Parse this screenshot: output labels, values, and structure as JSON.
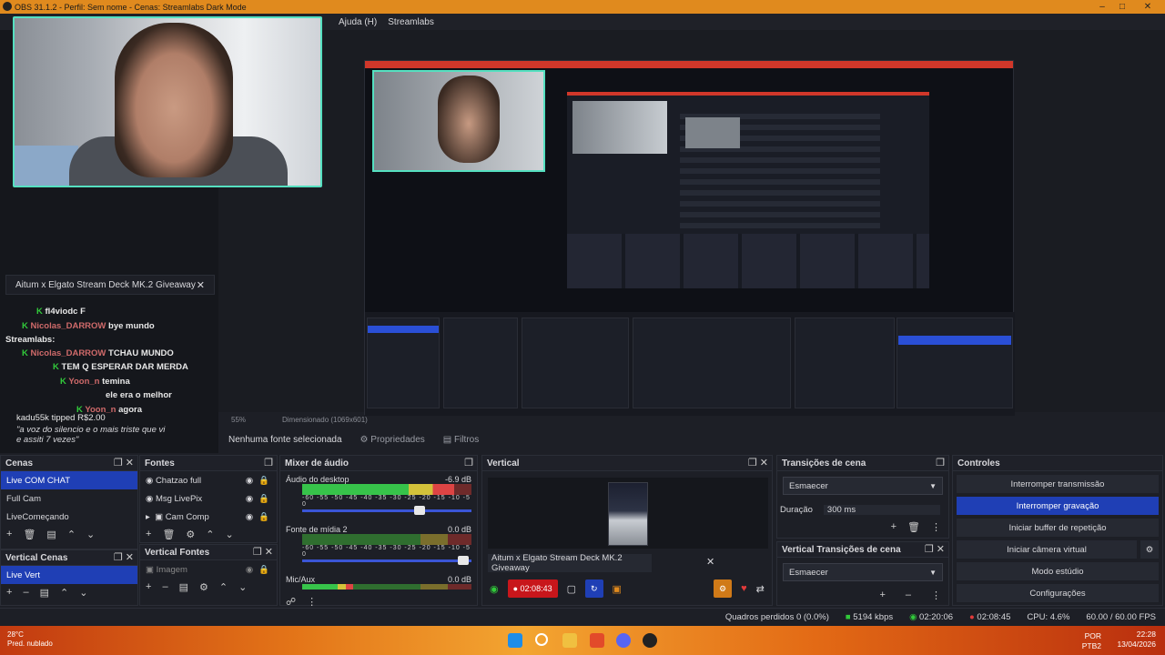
{
  "window": {
    "title": "OBS 31.1.2 - Perfil: Sem nome - Cenas: Streamlabs Dark Mode"
  },
  "menu": {
    "items": [
      "Ajuda (H)",
      "Streamlabs"
    ]
  },
  "chat_panel": {
    "giveaway": "Aitum x Elgato Stream Deck MK.2 Giveaway",
    "header": "Streamlabs:",
    "messages": [
      {
        "user": "fl4viodc",
        "text": "F"
      },
      {
        "user": "Nicolas_DARROW",
        "text": "bye mundo"
      },
      {
        "user": "Nicolas_DARROW",
        "text": "TCHAU MUNDO"
      },
      {
        "user": "",
        "text": "TEM Q ESPERAR DAR MERDA"
      },
      {
        "user": "Yoon_n",
        "text": "temina"
      },
      {
        "user": "",
        "text": "ele era o melhor"
      },
      {
        "user": "Yoon_n",
        "text": "agora"
      },
      {
        "user": "kadu55k",
        "text": "tipped R$2.00"
      },
      {
        "user": "",
        "text": "\"a voz do silencio e o mais triste que vi e assiti 7 vezes\""
      }
    ]
  },
  "preview": {
    "zoom": "55%",
    "dims": "Dimensionado (1069x601)"
  },
  "source_bar": {
    "status": "Nenhuma fonte selecionada",
    "props": "Propriedades",
    "filters": "Filtros"
  },
  "scenes": {
    "title": "Cenas",
    "items": [
      "Live COM CHAT",
      "Full Cam",
      "LiveComeçando"
    ]
  },
  "vertical_scenes": {
    "title": "Vertical Cenas",
    "items": [
      "Live Vert"
    ]
  },
  "sources": {
    "title": "Fontes",
    "items": [
      "Chatzao full",
      "Msg LivePix",
      "Cam Comp"
    ]
  },
  "vertical_sources": {
    "title": "Vertical Fontes",
    "items": [
      "Imagem"
    ]
  },
  "mixer": {
    "title": "Mixer de áudio",
    "ticks": "-60 -55 -50 -45 -40 -35 -30 -25 -20 -15 -10 -5 0",
    "channels": [
      {
        "name": "Áudio do desktop",
        "db": "-6.9 dB",
        "level": 0.9
      },
      {
        "name": "Fonte de mídia 2",
        "db": "0.0 dB",
        "level": 0.0
      },
      {
        "name": "Mic/Aux",
        "db": "0.0 dB",
        "level": 0.3
      }
    ]
  },
  "vertical": {
    "title": "Vertical",
    "giveaway": "Aitum x Elgato Stream Deck MK.2 Giveaway",
    "rec_time": "02:08:43"
  },
  "transitions": {
    "title": "Transições de cena",
    "select": "Esmaecer",
    "duration_label": "Duração",
    "duration": "300 ms"
  },
  "vertical_transitions": {
    "title": "Vertical Transições de cena",
    "select": "Esmaecer"
  },
  "controls": {
    "title": "Controles",
    "buttons": [
      "Interromper transmissão",
      "Interromper gravação",
      "Iniciar buffer de repetição",
      "Iniciar câmera virtual",
      "Modo estúdio",
      "Configurações"
    ]
  },
  "statusbar": {
    "dropped": "Quadros perdidos 0 (0.0%)",
    "bitrate": "5194 kbps",
    "stream_time": "02:20:06",
    "rec_time": "02:08:45",
    "cpu": "CPU: 4.6%",
    "fps": "60.00 / 60.00 FPS"
  },
  "taskbar": {
    "temp": "28°C",
    "weather": "Pred. nublado",
    "lang": "POR",
    "layout": "PTB2",
    "time": "22:28",
    "date": "13/04/2026"
  },
  "colors": {
    "accent": "#1f3fb5",
    "title_orange": "#e08a1e",
    "chat_green": "#31c93a",
    "cam_border": "#55e0c0"
  }
}
